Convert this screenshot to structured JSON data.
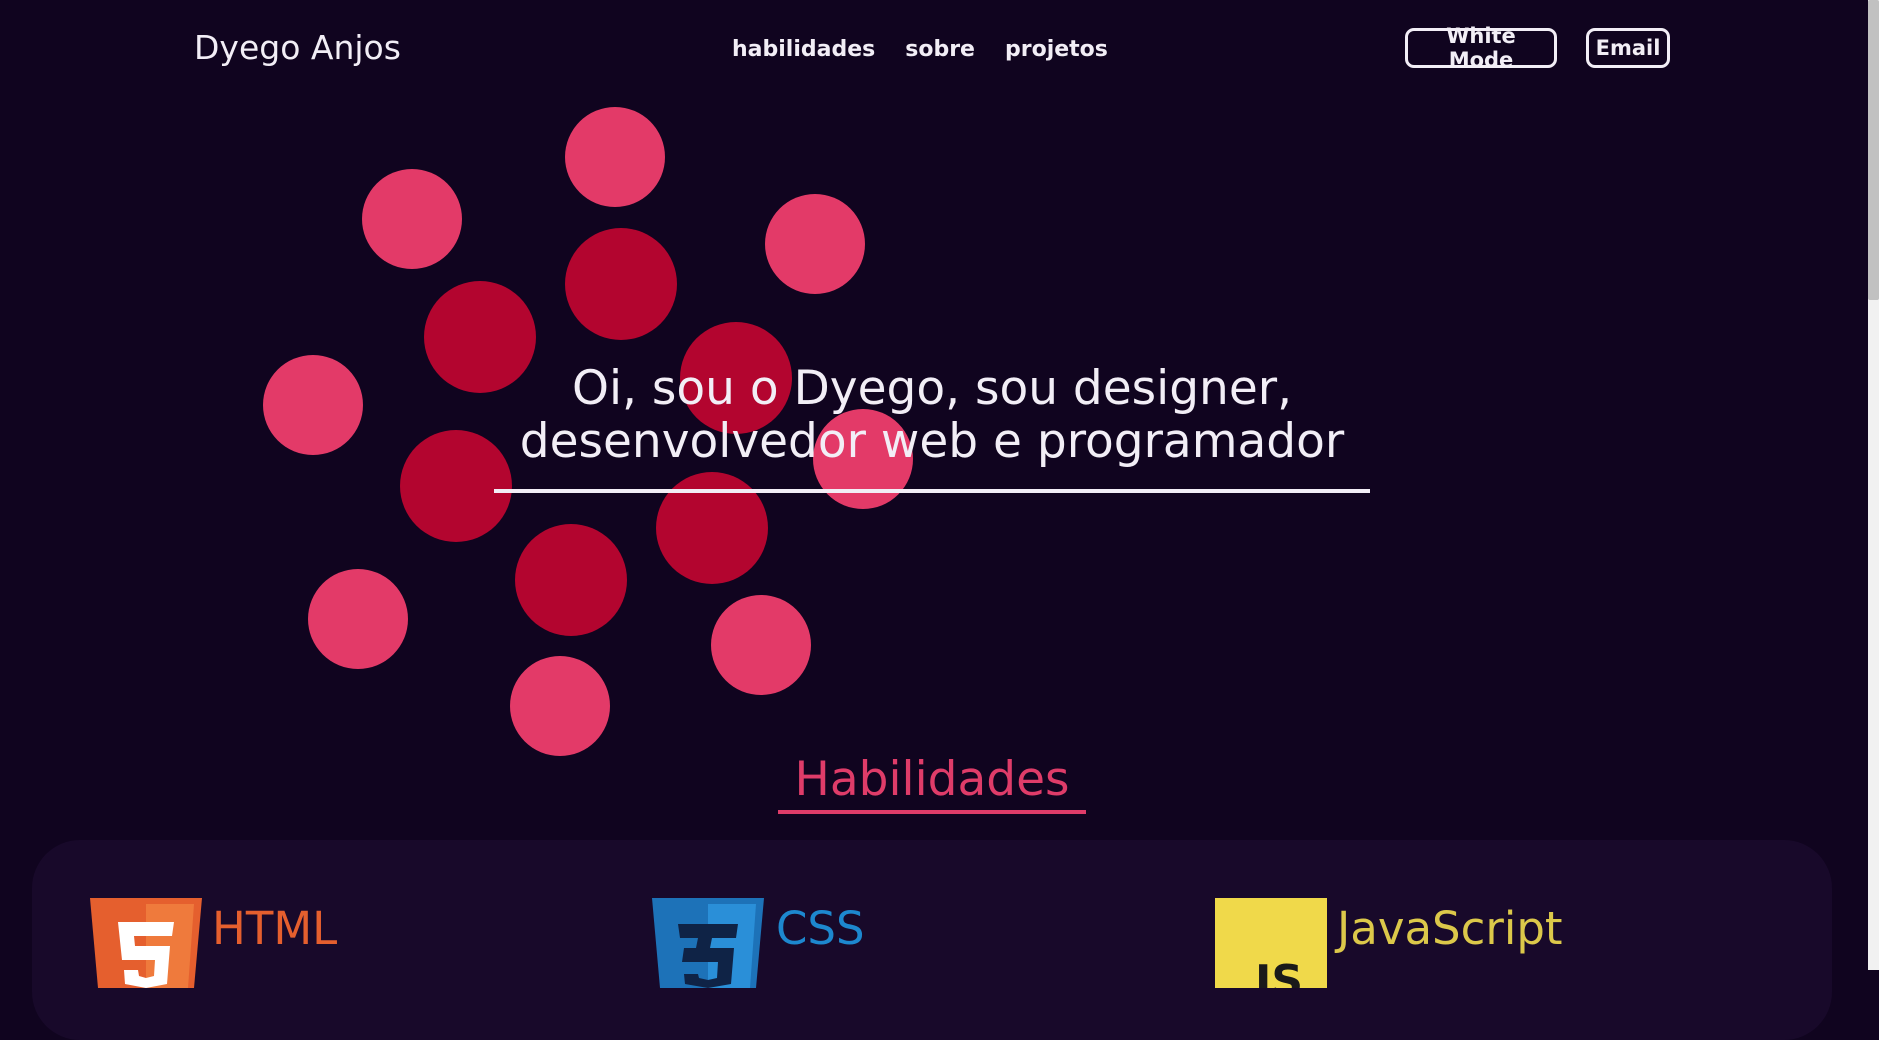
{
  "nav": {
    "logo": "Dyego Anjos",
    "links": [
      "habilidades",
      "sobre",
      "projetos"
    ],
    "white_mode": "White Mode",
    "email": "Email"
  },
  "hero": {
    "line1": "Oi, sou o Dyego, sou designer,",
    "line2": "desenvolvedor web e programador"
  },
  "skills": {
    "title": "Habilidades",
    "items": [
      {
        "label": "HTML",
        "icon": "html5-icon",
        "color": "#e55f2e"
      },
      {
        "label": "CSS",
        "icon": "css3-icon",
        "color": "#1d88cf"
      },
      {
        "label": "JavaScript",
        "icon": "js-icon",
        "color": "#dcc84a"
      }
    ]
  },
  "colors": {
    "background": "#10041f",
    "circle_light": "#e33a68",
    "circle_dark": "#b3052f",
    "accent": "#df3c69"
  }
}
